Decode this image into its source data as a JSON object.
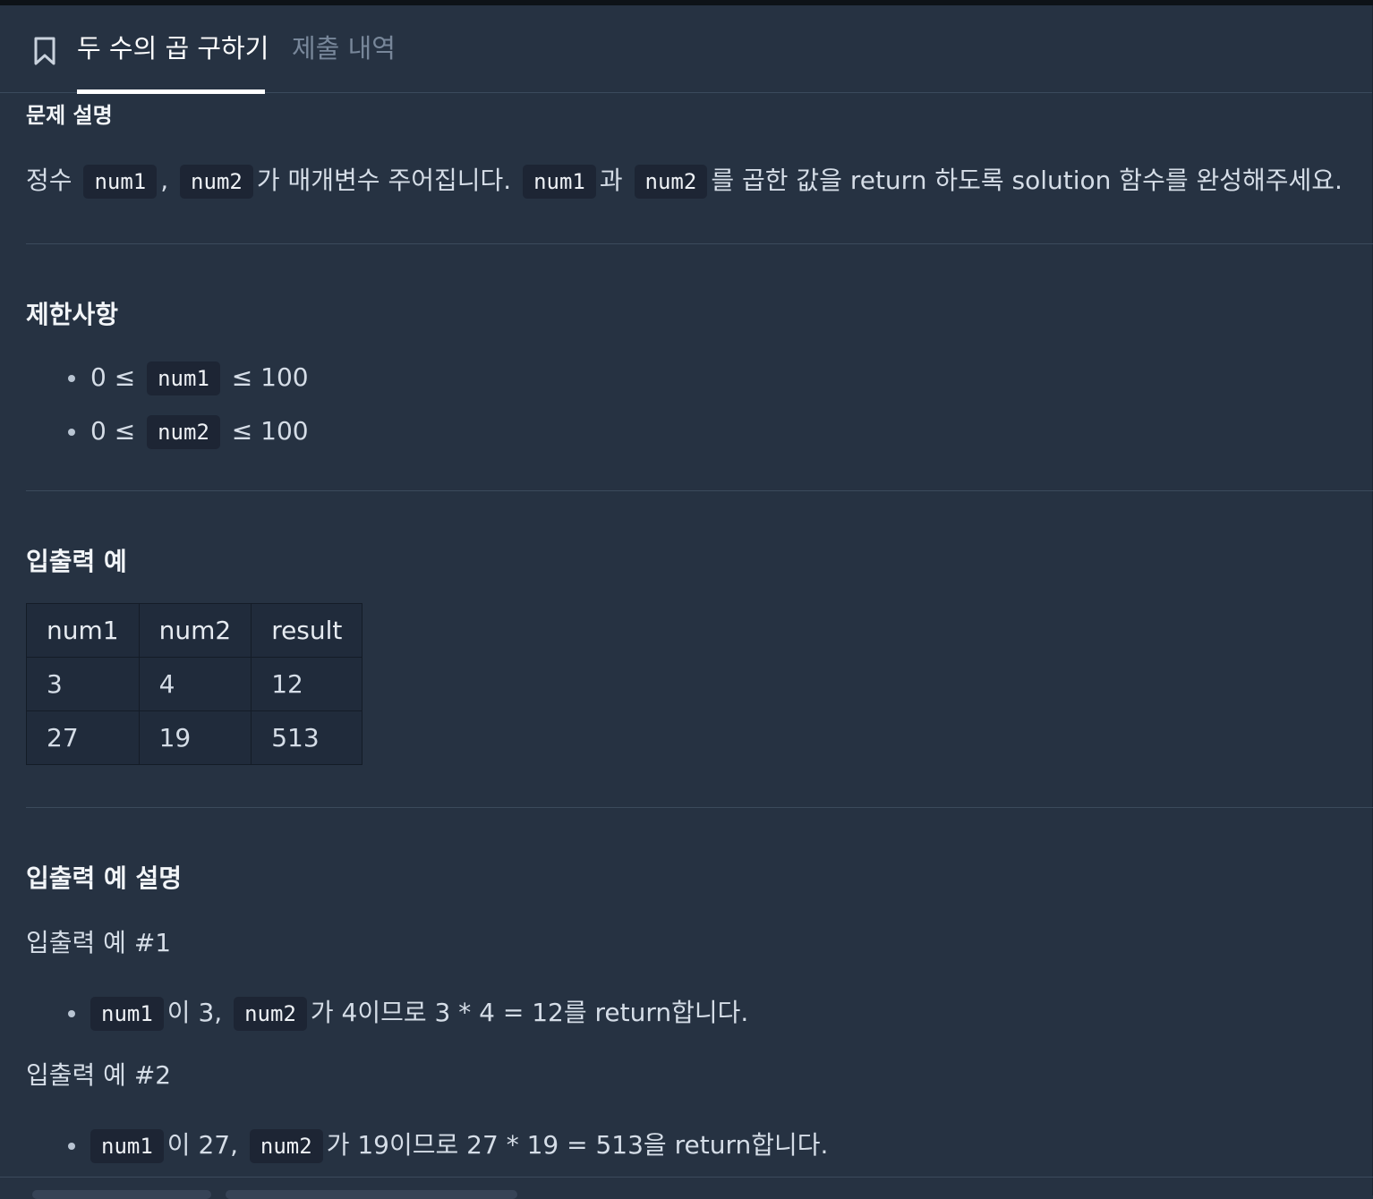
{
  "tabs": {
    "active": "두 수의 곱 구하기",
    "inactive": "제출 내역"
  },
  "description": {
    "title": "문제 설명",
    "t1": "정수",
    "code_num1": "num1",
    "sep": ",",
    "code_num2": "num2",
    "t2": "가 매개변수 주어집니다.",
    "t3": "과",
    "t4": "를 곱한 값을 return 하도록 solution 함수를 완성해주세요."
  },
  "constraints": {
    "title": "제한사항",
    "items": [
      {
        "pre": "0 ≤",
        "code": "num1",
        "post": "≤ 100"
      },
      {
        "pre": "0 ≤",
        "code": "num2",
        "post": "≤ 100"
      }
    ]
  },
  "io": {
    "title": "입출력 예",
    "headers": [
      "num1",
      "num2",
      "result"
    ],
    "rows": [
      [
        "3",
        "4",
        "12"
      ],
      [
        "27",
        "19",
        "513"
      ]
    ]
  },
  "io_desc": {
    "title": "입출력 예 설명",
    "examples": [
      {
        "title": "입출력 예 #1",
        "code1": "num1",
        "t1": "이 3,",
        "code2": "num2",
        "t2": "가 4이므로 3 * 4 = 12를 return합니다."
      },
      {
        "title": "입출력 예 #2",
        "code1": "num1",
        "t1": "이 27,",
        "code2": "num2",
        "t2": "가 19이므로 27 * 19 = 513을 return합니다."
      }
    ]
  },
  "colors": {
    "background": "#263242",
    "code_bg": "#1d2534",
    "table_bg": "#202b3b",
    "divider": "#3b4a5c",
    "inactive_tab": "#78879a"
  },
  "icons": {
    "bookmark": "bookmark-icon"
  }
}
